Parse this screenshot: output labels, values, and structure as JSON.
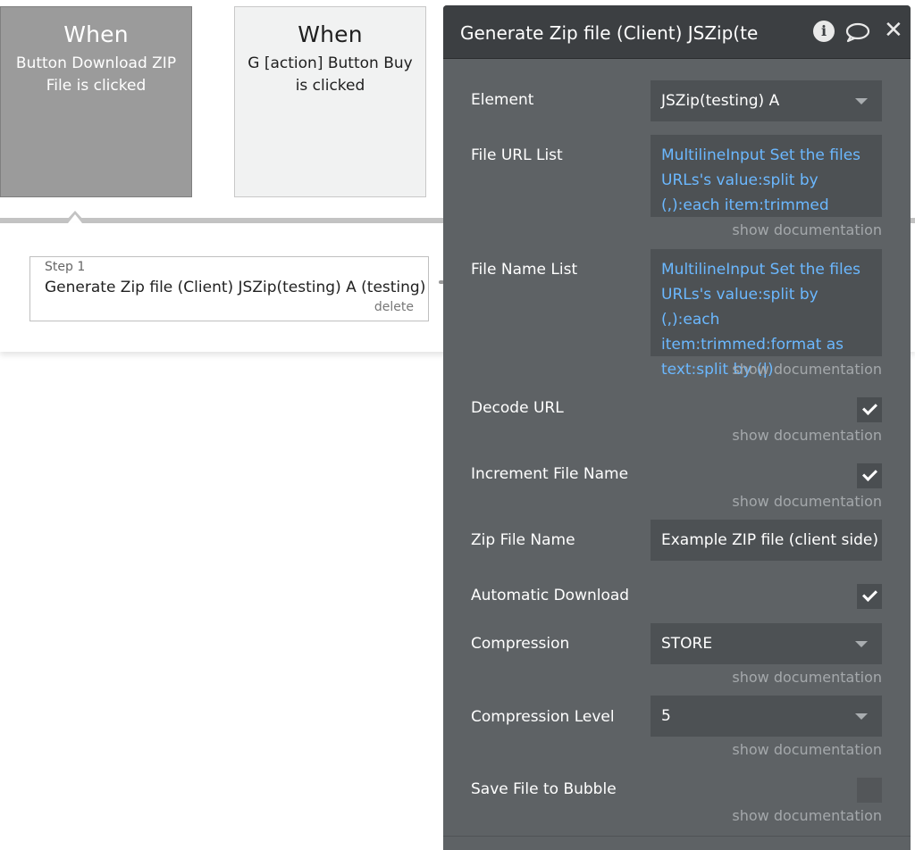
{
  "events": [
    {
      "title": "When",
      "description": "Button Download ZIP File is clicked",
      "selected": true
    },
    {
      "title": "When",
      "description": "G [action] Button Buy is clicked",
      "selected": false
    }
  ],
  "steps": [
    {
      "label": "Step 1",
      "title": "Generate Zip file (Client) JSZip(testing) A (testing)",
      "delete_label": "delete"
    }
  ],
  "property_editor": {
    "title": "Generate Zip file (Client) JSZip(te",
    "icons": {
      "info": "info-icon",
      "comment": "comment-icon",
      "close": "close-icon"
    },
    "info_glyph": "i",
    "close_glyph": "✕",
    "show_documentation_label": "show documentation",
    "fields": {
      "element": {
        "label": "Element",
        "value": "JSZip(testing) A"
      },
      "file_url_list": {
        "label": "File URL List",
        "value": "MultilineInput Set the files URLs's value:split by (,):each item:trimmed"
      },
      "file_name_list": {
        "label": "File Name List",
        "value": "MultilineInput Set the files URLs's value:split by (,):each item:trimmed:format as text:split by (|)"
      },
      "decode_url": {
        "label": "Decode URL",
        "checked": true
      },
      "increment_file_name": {
        "label": "Increment File Name",
        "checked": true
      },
      "zip_file_name": {
        "label": "Zip File Name",
        "value": "Example ZIP file (client side)"
      },
      "automatic_download": {
        "label": "Automatic Download",
        "checked": true
      },
      "compression": {
        "label": "Compression",
        "value": "STORE"
      },
      "compression_level": {
        "label": "Compression Level",
        "value": "5"
      },
      "save_file_to_bubble": {
        "label": "Save File to Bubble",
        "checked": false
      }
    }
  },
  "colors": {
    "panel_bg": "#5e6265",
    "header_bg": "#3c3f42",
    "field_bg": "#4d5154",
    "expression_text": "#6bb8ff",
    "selected_event_bg": "#9b9b9b",
    "event_bg": "#f1f2f2"
  }
}
